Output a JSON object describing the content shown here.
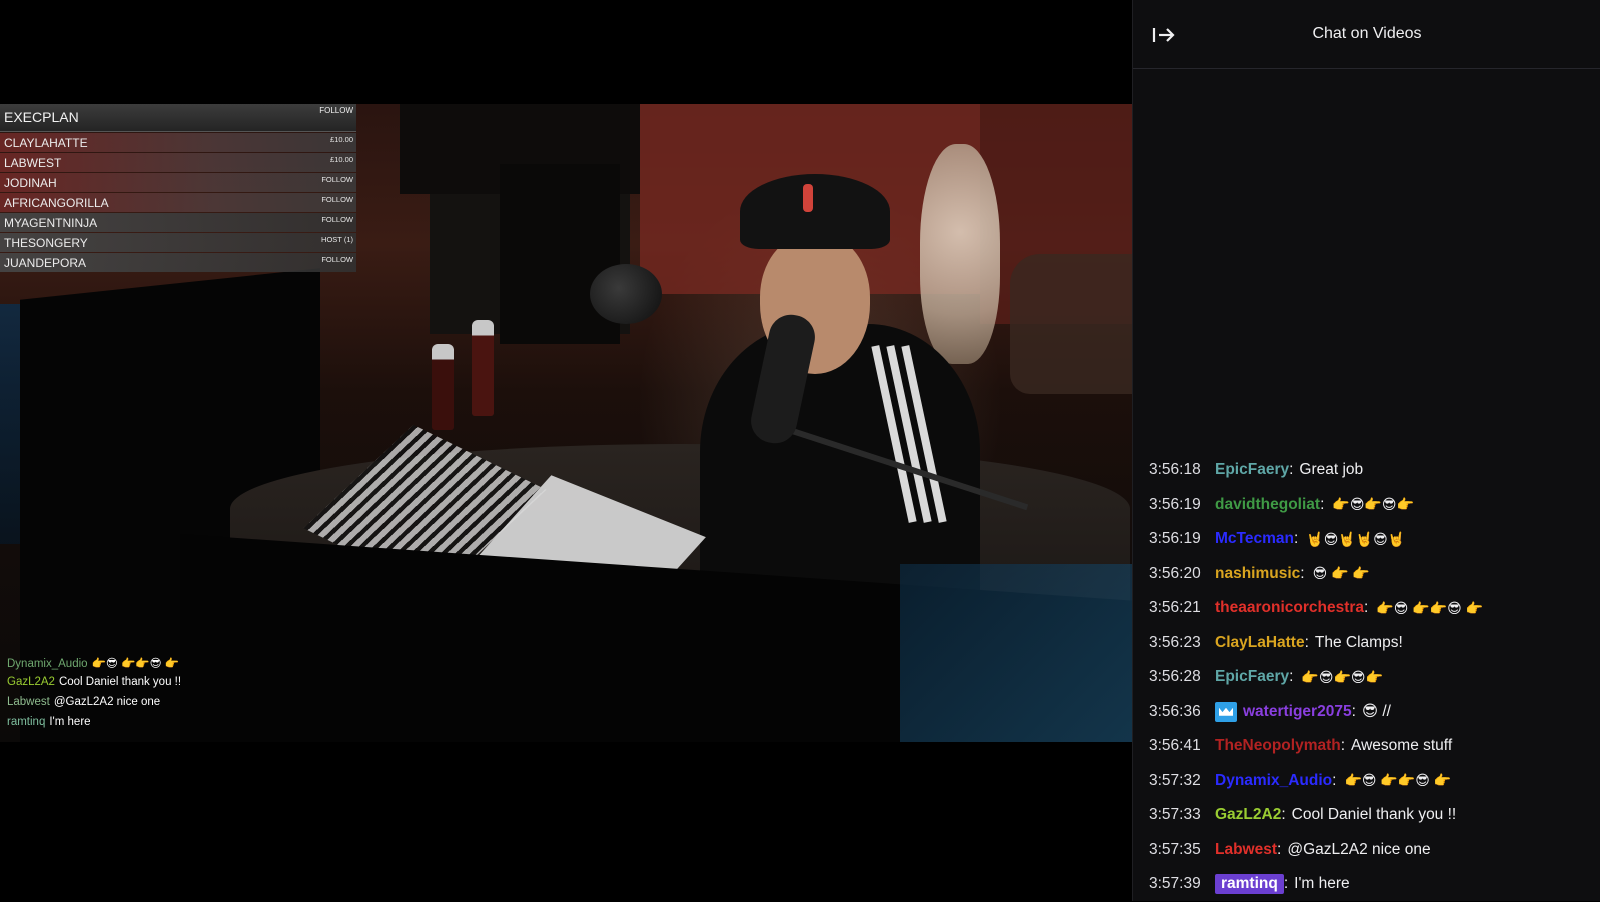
{
  "chat_panel": {
    "title": "Chat on Videos",
    "collapse_icon": "collapse-right-arrow-icon",
    "messages": [
      {
        "time": "3:56:18",
        "user": "EpicFaery",
        "color": "#5fa7a7",
        "text": "Great job"
      },
      {
        "time": "3:56:19",
        "user": "davidthegoliat",
        "color": "#3f9a45",
        "text": "👉😎👉😎👉"
      },
      {
        "time": "3:56:19",
        "user": "McTecman",
        "color": "#2b2bff",
        "text": "🤘😎🤘🤘😎🤘"
      },
      {
        "time": "3:56:20",
        "user": "nashimusic",
        "color": "#daa520",
        "text": "😎 👉 👉"
      },
      {
        "time": "3:56:21",
        "user": "theaaronicorchestra",
        "color": "#e0302a",
        "text": "👉😎 👉👉😎 👉"
      },
      {
        "time": "3:56:23",
        "user": "ClayLaHatte",
        "color": "#daa520",
        "text": "The Clamps!"
      },
      {
        "time": "3:56:28",
        "user": "EpicFaery",
        "color": "#5fa7a7",
        "text": "👉😎👉😎👉"
      },
      {
        "time": "3:56:36",
        "user": "watertiger2075",
        "color": "#8a3fe0",
        "text": "😎 //",
        "badge": "crown-badge-icon"
      },
      {
        "time": "3:56:41",
        "user": "TheNeopolymath",
        "color": "#b22222",
        "text": "Awesome stuff"
      },
      {
        "time": "3:57:32",
        "user": "Dynamix_Audio",
        "color": "#2b2bff",
        "text": "👉😎 👉👉😎 👉"
      },
      {
        "time": "3:57:33",
        "user": "GazL2A2",
        "color": "#9acd32",
        "text": "Cool Daniel thank you !!"
      },
      {
        "time": "3:57:35",
        "user": "Labwest",
        "color": "#e0302a",
        "text": "@GazL2A2 nice one"
      },
      {
        "time": "3:57:39",
        "user": "ramtinq",
        "color": "#ffffff",
        "text": "I'm here",
        "highlight": "#6b3fd1"
      }
    ]
  },
  "leaderboard": {
    "title": "EXECPLAN",
    "title_tag": "FOLLOW",
    "rows": [
      {
        "name": "CLAYLAHATTE",
        "tag": "£10.00"
      },
      {
        "name": "LABWEST",
        "tag": "£10.00"
      },
      {
        "name": "JODINAH",
        "tag": "FOLLOW"
      },
      {
        "name": "AFRICANGORILLA",
        "tag": "FOLLOW"
      },
      {
        "name": "MYAGENTNINJA",
        "tag": "FOLLOW"
      },
      {
        "name": "THESONGERY",
        "tag": "HOST (1)"
      },
      {
        "name": "JUANDEPORA",
        "tag": "FOLLOW"
      }
    ]
  },
  "video_chat": {
    "lines": [
      {
        "user": "Dynamix_Audio",
        "color": "#6fa86f",
        "text": "👉😎 👉👉😎 👉"
      },
      {
        "user": "GazL2A2",
        "color": "#9acd32",
        "text": "Cool Daniel thank you !!"
      },
      {
        "user": "Labwest",
        "color": "#8fbc8f",
        "text": "@GazL2A2 nice one"
      },
      {
        "user": "ramtinq",
        "color": "#7fbf9f",
        "text": "I'm here"
      }
    ]
  }
}
